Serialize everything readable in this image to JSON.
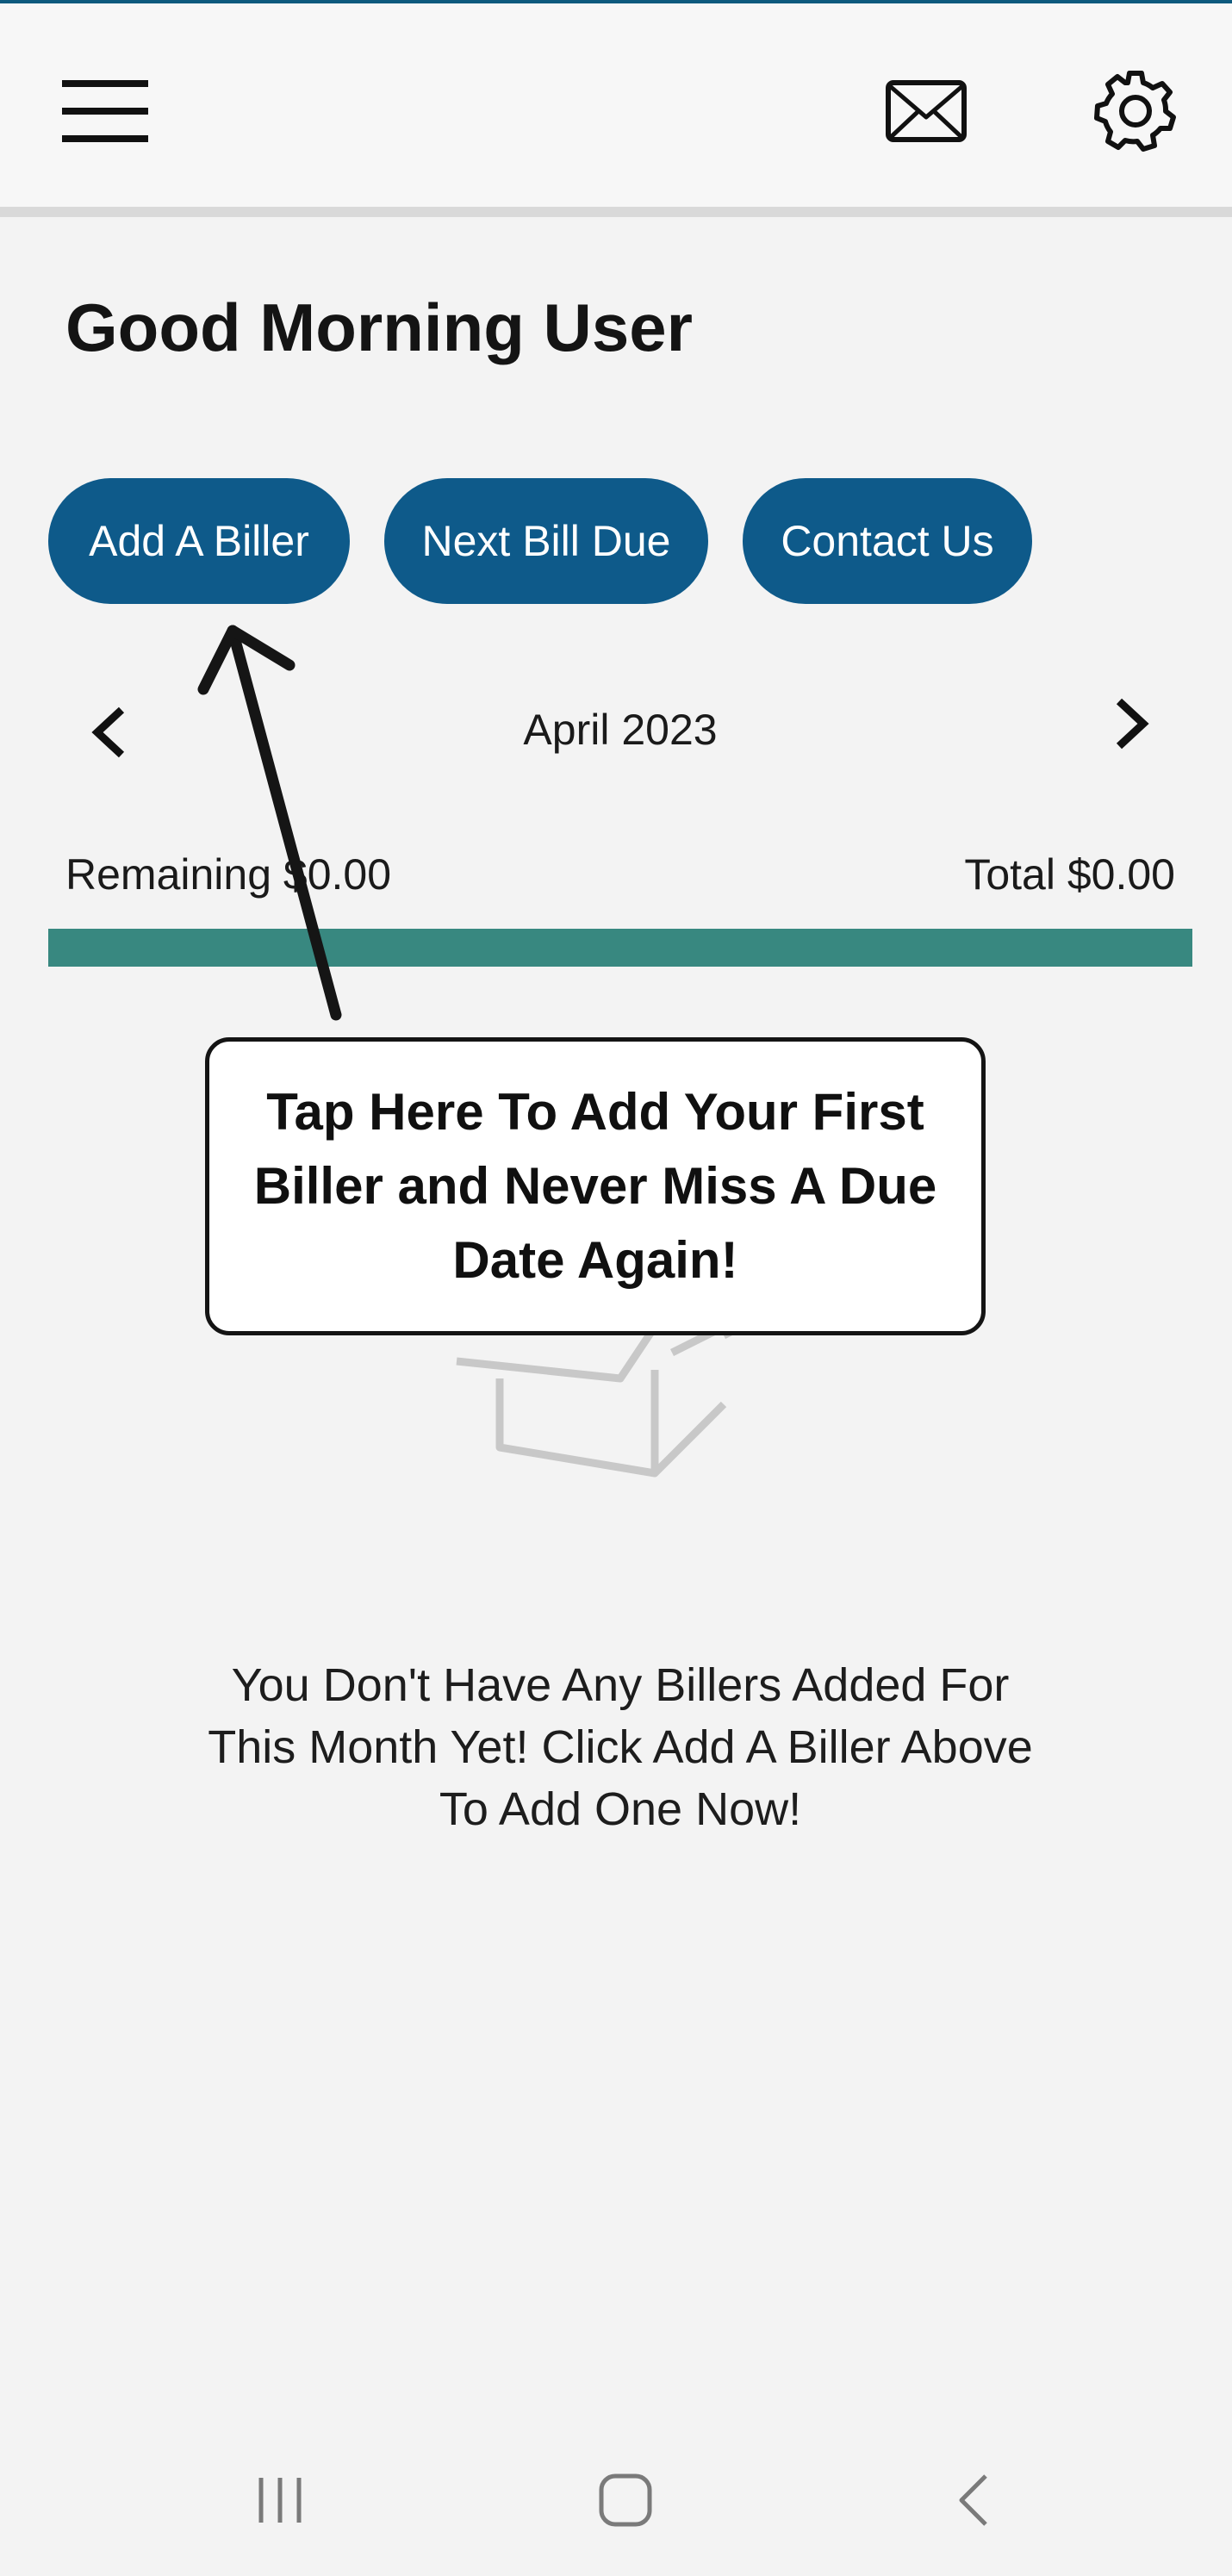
{
  "header": {
    "menu_icon": "hamburger-menu-icon",
    "mail_icon": "envelope-icon",
    "settings_icon": "gear-icon"
  },
  "greeting": "Good Morning User",
  "actions": {
    "add_biller": "Add A Biller",
    "next_bill_due": "Next Bill Due",
    "contact_us": "Contact Us"
  },
  "month_nav": {
    "month": "April 2023",
    "prev_icon": "chevron-left-icon",
    "next_icon": "chevron-right-icon"
  },
  "summary": {
    "remaining": "Remaining $0.00",
    "total": "Total $0.00",
    "progress_fraction": 1.0
  },
  "callout": {
    "text": "Tap Here To Add Your First Biller and Never Miss A Due Date Again!"
  },
  "empty_state": {
    "icon": "open-box-icon",
    "message": "You Don't Have Any Billers Added For This Month Yet! Click Add A Biller Above To Add One Now!"
  },
  "system_nav": {
    "recent_icon": "recent-apps-icon",
    "home_icon": "home-icon",
    "back_icon": "back-icon"
  },
  "colors": {
    "accent": "#0e5a8a",
    "progress": "#388880",
    "background": "#f3f3f3"
  }
}
